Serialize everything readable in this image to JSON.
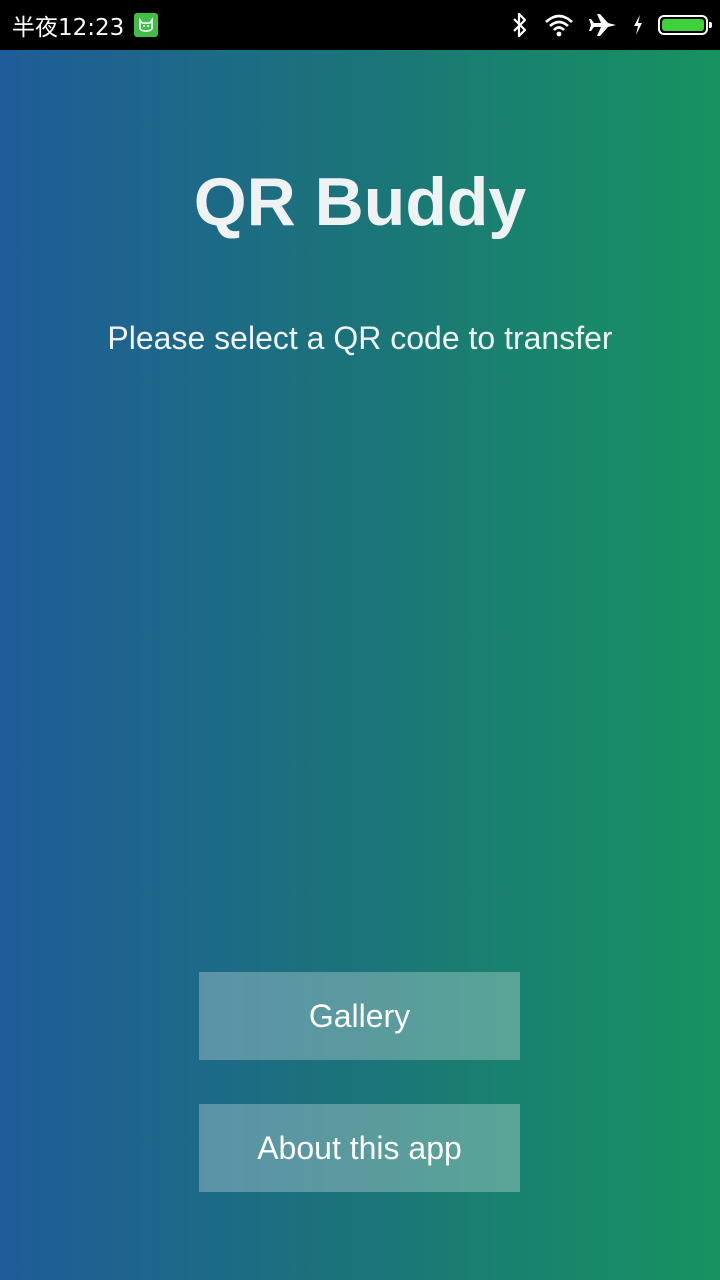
{
  "status_bar": {
    "time": "半夜12:23",
    "notification_icon": "cat-notification-icon",
    "icons": [
      "bluetooth-icon",
      "wifi-icon",
      "airplane-icon",
      "charging-icon",
      "battery-icon"
    ],
    "battery_level": 1.0
  },
  "app": {
    "title": "QR Buddy",
    "subtitle": "Please select a QR code to transfer",
    "buttons": {
      "gallery": "Gallery",
      "about": "About this app"
    },
    "colors": {
      "gradient_start": "#1f5c99",
      "gradient_end": "#179360",
      "text": "#eef2f3"
    }
  }
}
